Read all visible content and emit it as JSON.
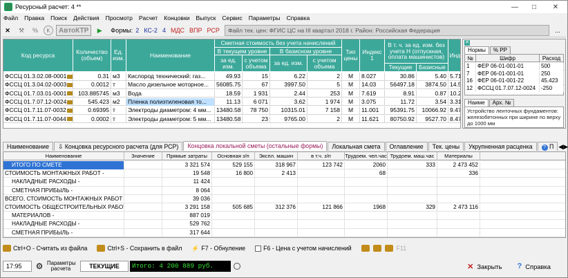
{
  "window": {
    "title": "Ресурсный расчет: 4 **"
  },
  "menu": [
    "Файл",
    "Правка",
    "Поиск",
    "Действия",
    "Просмотр",
    "Расчет",
    "Концовки",
    "Выпуск",
    "Сервис",
    "Параметры",
    "Справка"
  ],
  "toolbar": {
    "kto_label": "АвтоКТР",
    "forms_label": "Формы:",
    "forms": [
      "2",
      "КС-2",
      "4",
      "МДС",
      "ВПР",
      "РСР"
    ],
    "price_file": "Файл тек. цен: ФГИС ЦС на III квартал 2018 г.  Район: Российская Федерация",
    "dots": "..."
  },
  "top_grid": {
    "headers": {
      "code": "Код ресурса",
      "qty": "Количество (объем)",
      "unit": "Ед. изм.",
      "name": "Наименование",
      "cost_group": "Сметная стоимость без учета начислений",
      "current": "В текущем уровне",
      "base": "В базисном уровне",
      "per_unit_cur": "за ед. изм.",
      "with_vol_cur": "с учетом объема",
      "per_unit_base": "за ед. изм.",
      "with_vol_base": "с учетом объема",
      "price_type": "Тип цены",
      "index": "Индекс 1",
      "incl_group": "В т. ч. за ед. изм. без учета Н (отпускная, оплата машинистов)",
      "incl_current": "Текущие",
      "incl_base": "Базисные",
      "extra": "Инд"
    },
    "rows": [
      {
        "code": "ФССЦ 01.3.02.08-0001",
        "qty": "0.31",
        "unit": "м3",
        "name": "Кислород технический: газ...",
        "cur_unit": "49.93",
        "cur_vol": "15",
        "base_unit": "6.22",
        "base_vol": "2",
        "type": "М",
        "index": "8.027",
        "incl_cur": "30.86",
        "incl_base": "5.40",
        "extra": "5.715"
      },
      {
        "code": "ФССЦ 01.3.04.02-0003",
        "qty": "0.0012",
        "unit": "т",
        "name": "Масло дизельное моторное...",
        "cur_unit": "56085.75",
        "cur_vol": "67",
        "base_unit": "3997.50",
        "base_vol": "5",
        "type": "М",
        "index": "14.03",
        "incl_cur": "56497.18",
        "incl_base": "3874.50",
        "extra": "14.58"
      },
      {
        "code": "ФССЦ 01.7.03.01-0001",
        "qty": "103.885745",
        "unit": "м3",
        "name": "Вода",
        "cur_unit": "18.59",
        "cur_vol": "1 931",
        "base_unit": "2.44",
        "base_vol": "253",
        "type": "М",
        "index": "7.619",
        "incl_cur": "8.91",
        "incl_base": "0.87",
        "extra": "10.24"
      },
      {
        "code": "ФССЦ 01.7.07.12-0024",
        "qty": "545.423",
        "unit": "м2",
        "name": "Пленка полиэтиленовая то...",
        "cur_unit": "11.13",
        "cur_vol": "6 071",
        "base_unit": "3.62",
        "base_vol": "1 974",
        "type": "М",
        "index": "3.075",
        "incl_cur": "11.72",
        "incl_base": "3.54",
        "extra": "3.311"
      },
      {
        "code": "ФССЦ 01.7.11.07-0032",
        "qty": "0.69395",
        "unit": "т",
        "name": "Электроды диаметром: 4 мм...",
        "cur_unit": "13480.58",
        "cur_vol": "78 750",
        "base_unit": "10315.01",
        "base_vol": "7 158",
        "type": "М",
        "index": "11.001",
        "incl_cur": "95391.75",
        "incl_base": "10066.92",
        "extra": "9.476"
      },
      {
        "code": "ФССЦ 01.7.11.07-0044",
        "qty": "0.0002",
        "unit": "т",
        "name": "Электроды диаметром: 5 мм...",
        "cur_unit": "13480.58",
        "cur_vol": "23",
        "base_unit": "9765.00",
        "base_vol": "2",
        "type": "М",
        "index": "11.621",
        "incl_cur": "80750.92",
        "incl_base": "9527.70",
        "extra": "8.475"
      }
    ]
  },
  "right_panel": {
    "tabs": [
      "Нормы",
      "% РР"
    ],
    "headers": [
      "№",
      "Шифр",
      "Расход"
    ],
    "rows": [
      {
        "n": "1",
        "code": "ФЕР 06-01-001-01",
        "value": "500"
      },
      {
        "n": "7",
        "code": "ФЕР 06-01-001-01",
        "value": "250"
      },
      {
        "n": "16",
        "code": "ФЕР 06-01-001-22",
        "value": "45.423"
      },
      {
        "n": "12",
        "code": "ФССЦ 01.7.07.12-0024",
        "value": "-250"
      }
    ],
    "tabs2": [
      "Наиме",
      "Арх. №"
    ],
    "note": "Устройство ленточных фундаментов: железобетонных при ширине по верху до 1000 мм"
  },
  "mid_tabs": [
    "Наименование",
    "Концовка ресурсного расчета (для РСР)",
    "Концовка локальной сметы (остальные формы)",
    "Локальная смета",
    "Оглавление",
    "Тек. цены",
    "Укрупненная расценка",
    "П"
  ],
  "bottom_grid": {
    "headers": [
      "Наименование",
      "Значение",
      "Прямые затраты",
      "Основная з/п",
      "Экспл. машин",
      "в т.ч. з/п",
      "Трудоем. чел.час",
      "Трудоем. маш.час",
      "Материалы"
    ],
    "rows": [
      {
        "name": "ИТОГО ПО СМЕТЕ",
        "v": "",
        "pz": "3 321 574",
        "oz": "529 155",
        "em": "318 967",
        "vz": "123 742",
        "tc": "2060",
        "tm": "333",
        "mat": "2 473 452"
      },
      {
        "name": "СТОИМОСТЬ МОНТАЖНЫХ РАБОТ -",
        "v": "",
        "pz": "19 548",
        "oz": "16 800",
        "em": "2 413",
        "vz": "",
        "tc": "68",
        "tm": "",
        "mat": "336"
      },
      {
        "name": "НАКЛАДНЫЕ РАСХОДЫ -",
        "v": "",
        "pz": "11 424",
        "oz": "",
        "em": "",
        "vz": "",
        "tc": "",
        "tm": "",
        "mat": ""
      },
      {
        "name": "СМЕТНАЯ ПРИБЫЛЬ -",
        "v": "",
        "pz": "8 064",
        "oz": "",
        "em": "",
        "vz": "",
        "tc": "",
        "tm": "",
        "mat": ""
      },
      {
        "name": "ВСЕГО, СТОИМОСТЬ МОНТАЖНЫХ РАБОТ -",
        "v": "",
        "pz": "39 036",
        "oz": "",
        "em": "",
        "vz": "",
        "tc": "",
        "tm": "",
        "mat": ""
      },
      {
        "name": "СТОИМОСТЬ ОБЩЕСТРОИТЕЛЬНЫХ РАБОТ -",
        "v": "",
        "pz": "3 291 158",
        "oz": "505 685",
        "em": "312 376",
        "vz": "121 866",
        "tc": "1968",
        "tm": "329",
        "mat": "2 473 116"
      },
      {
        "name": "МАТЕРИАЛОВ -",
        "v": "",
        "pz": "887 019",
        "oz": "",
        "em": "",
        "vz": "",
        "tc": "",
        "tm": "",
        "mat": ""
      },
      {
        "name": "НАКЛАДНЫЕ РАСХОДЫ -",
        "v": "",
        "pz": "529 762",
        "oz": "",
        "em": "",
        "vz": "",
        "tc": "",
        "tm": "",
        "mat": ""
      },
      {
        "name": "СМЕТНАЯ ПРИБЫЛЬ -",
        "v": "",
        "pz": "317 644",
        "oz": "",
        "em": "",
        "vz": "",
        "tc": "",
        "tm": "",
        "mat": ""
      }
    ]
  },
  "hotkeys": {
    "read": "Ctrl+O - Считать из файла",
    "save": "Ctrl+S - Сохранить в файл",
    "reset": "F7 - Обнуление",
    "price": "F6 - Цена  с учетом начислений",
    "f11": "F11"
  },
  "status": {
    "time": "17:95",
    "params": "Параметры расчета",
    "current": "ТЕКУЩИЕ",
    "total": "Итого: 4 200 889 руб.",
    "close": "Закрыть",
    "help": "Справка"
  },
  "colors": {
    "header_teal": "#3ca89a",
    "selected_blue": "#2f73d4",
    "total_green": "#38e038"
  }
}
